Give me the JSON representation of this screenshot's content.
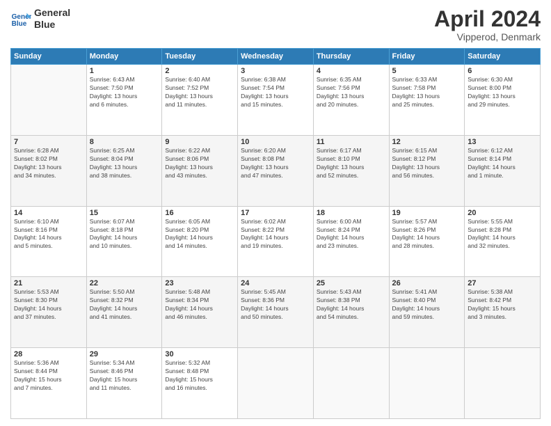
{
  "header": {
    "logo_line1": "General",
    "logo_line2": "Blue",
    "month_title": "April 2024",
    "location": "Vipperod, Denmark"
  },
  "weekdays": [
    "Sunday",
    "Monday",
    "Tuesday",
    "Wednesday",
    "Thursday",
    "Friday",
    "Saturday"
  ],
  "weeks": [
    [
      {
        "num": "",
        "info": ""
      },
      {
        "num": "1",
        "info": "Sunrise: 6:43 AM\nSunset: 7:50 PM\nDaylight: 13 hours\nand 6 minutes."
      },
      {
        "num": "2",
        "info": "Sunrise: 6:40 AM\nSunset: 7:52 PM\nDaylight: 13 hours\nand 11 minutes."
      },
      {
        "num": "3",
        "info": "Sunrise: 6:38 AM\nSunset: 7:54 PM\nDaylight: 13 hours\nand 15 minutes."
      },
      {
        "num": "4",
        "info": "Sunrise: 6:35 AM\nSunset: 7:56 PM\nDaylight: 13 hours\nand 20 minutes."
      },
      {
        "num": "5",
        "info": "Sunrise: 6:33 AM\nSunset: 7:58 PM\nDaylight: 13 hours\nand 25 minutes."
      },
      {
        "num": "6",
        "info": "Sunrise: 6:30 AM\nSunset: 8:00 PM\nDaylight: 13 hours\nand 29 minutes."
      }
    ],
    [
      {
        "num": "7",
        "info": "Sunrise: 6:28 AM\nSunset: 8:02 PM\nDaylight: 13 hours\nand 34 minutes."
      },
      {
        "num": "8",
        "info": "Sunrise: 6:25 AM\nSunset: 8:04 PM\nDaylight: 13 hours\nand 38 minutes."
      },
      {
        "num": "9",
        "info": "Sunrise: 6:22 AM\nSunset: 8:06 PM\nDaylight: 13 hours\nand 43 minutes."
      },
      {
        "num": "10",
        "info": "Sunrise: 6:20 AM\nSunset: 8:08 PM\nDaylight: 13 hours\nand 47 minutes."
      },
      {
        "num": "11",
        "info": "Sunrise: 6:17 AM\nSunset: 8:10 PM\nDaylight: 13 hours\nand 52 minutes."
      },
      {
        "num": "12",
        "info": "Sunrise: 6:15 AM\nSunset: 8:12 PM\nDaylight: 13 hours\nand 56 minutes."
      },
      {
        "num": "13",
        "info": "Sunrise: 6:12 AM\nSunset: 8:14 PM\nDaylight: 14 hours\nand 1 minute."
      }
    ],
    [
      {
        "num": "14",
        "info": "Sunrise: 6:10 AM\nSunset: 8:16 PM\nDaylight: 14 hours\nand 5 minutes."
      },
      {
        "num": "15",
        "info": "Sunrise: 6:07 AM\nSunset: 8:18 PM\nDaylight: 14 hours\nand 10 minutes."
      },
      {
        "num": "16",
        "info": "Sunrise: 6:05 AM\nSunset: 8:20 PM\nDaylight: 14 hours\nand 14 minutes."
      },
      {
        "num": "17",
        "info": "Sunrise: 6:02 AM\nSunset: 8:22 PM\nDaylight: 14 hours\nand 19 minutes."
      },
      {
        "num": "18",
        "info": "Sunrise: 6:00 AM\nSunset: 8:24 PM\nDaylight: 14 hours\nand 23 minutes."
      },
      {
        "num": "19",
        "info": "Sunrise: 5:57 AM\nSunset: 8:26 PM\nDaylight: 14 hours\nand 28 minutes."
      },
      {
        "num": "20",
        "info": "Sunrise: 5:55 AM\nSunset: 8:28 PM\nDaylight: 14 hours\nand 32 minutes."
      }
    ],
    [
      {
        "num": "21",
        "info": "Sunrise: 5:53 AM\nSunset: 8:30 PM\nDaylight: 14 hours\nand 37 minutes."
      },
      {
        "num": "22",
        "info": "Sunrise: 5:50 AM\nSunset: 8:32 PM\nDaylight: 14 hours\nand 41 minutes."
      },
      {
        "num": "23",
        "info": "Sunrise: 5:48 AM\nSunset: 8:34 PM\nDaylight: 14 hours\nand 46 minutes."
      },
      {
        "num": "24",
        "info": "Sunrise: 5:45 AM\nSunset: 8:36 PM\nDaylight: 14 hours\nand 50 minutes."
      },
      {
        "num": "25",
        "info": "Sunrise: 5:43 AM\nSunset: 8:38 PM\nDaylight: 14 hours\nand 54 minutes."
      },
      {
        "num": "26",
        "info": "Sunrise: 5:41 AM\nSunset: 8:40 PM\nDaylight: 14 hours\nand 59 minutes."
      },
      {
        "num": "27",
        "info": "Sunrise: 5:38 AM\nSunset: 8:42 PM\nDaylight: 15 hours\nand 3 minutes."
      }
    ],
    [
      {
        "num": "28",
        "info": "Sunrise: 5:36 AM\nSunset: 8:44 PM\nDaylight: 15 hours\nand 7 minutes."
      },
      {
        "num": "29",
        "info": "Sunrise: 5:34 AM\nSunset: 8:46 PM\nDaylight: 15 hours\nand 11 minutes."
      },
      {
        "num": "30",
        "info": "Sunrise: 5:32 AM\nSunset: 8:48 PM\nDaylight: 15 hours\nand 16 minutes."
      },
      {
        "num": "",
        "info": ""
      },
      {
        "num": "",
        "info": ""
      },
      {
        "num": "",
        "info": ""
      },
      {
        "num": "",
        "info": ""
      }
    ]
  ]
}
